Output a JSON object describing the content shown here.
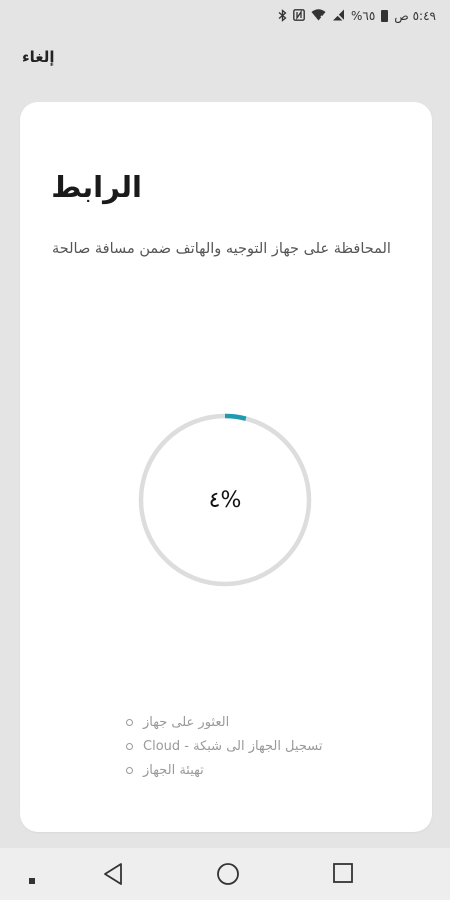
{
  "status_bar": {
    "time": "٥:٤٩ ص",
    "battery": "%٦٥",
    "icons": [
      "bluetooth-icon",
      "nfc-icon",
      "wifi-icon",
      "signal-off-icon",
      "battery-icon"
    ]
  },
  "app_bar": {
    "cancel_label": "إلغاء"
  },
  "card": {
    "title": "الرابط",
    "description": "المحافظة على جهاز التوجيه والهاتف ضمن مسافة صالحة",
    "progress": {
      "percent_text": "٤%",
      "value": 0.04,
      "track_color": "#dddddd",
      "fill_color": "#1f9bb0"
    },
    "steps": [
      {
        "label": "العثور على جهاز"
      },
      {
        "label": "تسجيل الجهاز الى شبكة - Cloud"
      },
      {
        "label": "تهيئة الجهاز"
      }
    ]
  },
  "nav_bar": {
    "buttons": [
      "recents-dot-icon",
      "back-icon",
      "home-icon",
      "overview-icon"
    ]
  }
}
